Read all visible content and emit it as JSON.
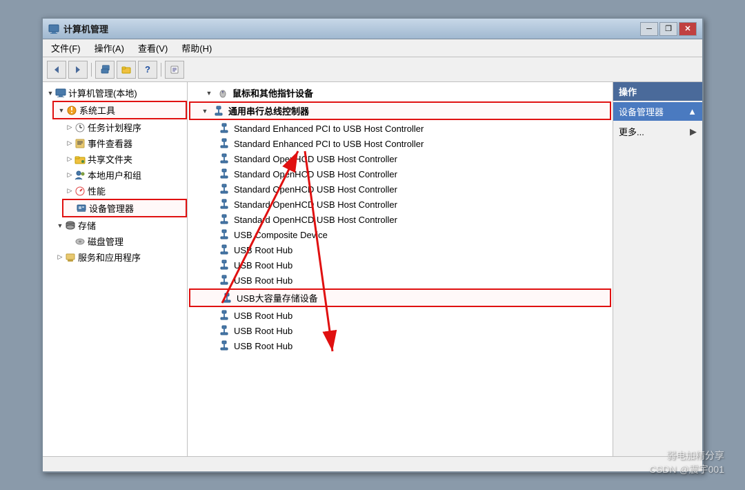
{
  "window": {
    "title": "计算机管理",
    "controls": {
      "minimize": "─",
      "restore": "❐",
      "close": "✕"
    }
  },
  "menu": {
    "items": [
      {
        "id": "file",
        "label": "文件(F)"
      },
      {
        "id": "action",
        "label": "操作(A)"
      },
      {
        "id": "view",
        "label": "查看(V)"
      },
      {
        "id": "help",
        "label": "帮助(H)"
      }
    ]
  },
  "left_panel": {
    "root": "计算机管理(本地)",
    "items": [
      {
        "id": "system-tools",
        "label": "系统工具",
        "indent": 1,
        "expanded": true,
        "highlighted": true
      },
      {
        "id": "task-scheduler",
        "label": "任务计划程序",
        "indent": 2
      },
      {
        "id": "event-viewer",
        "label": "事件查看器",
        "indent": 2
      },
      {
        "id": "shared-folders",
        "label": "共享文件夹",
        "indent": 2
      },
      {
        "id": "local-users",
        "label": "本地用户和组",
        "indent": 2
      },
      {
        "id": "performance",
        "label": "性能",
        "indent": 2
      },
      {
        "id": "device-manager",
        "label": "设备管理器",
        "indent": 2,
        "highlighted": true
      },
      {
        "id": "storage",
        "label": "存储",
        "indent": 1,
        "expanded": true
      },
      {
        "id": "disk-management",
        "label": "磁盘管理",
        "indent": 2
      },
      {
        "id": "services",
        "label": "服务和应用程序",
        "indent": 1
      }
    ]
  },
  "middle_panel": {
    "categories": [
      {
        "id": "mouse-devices",
        "label": "鼠标和其他指针设备",
        "expanded": true,
        "indent": 0
      },
      {
        "id": "usb-controller",
        "label": "通用串行总线控制器",
        "expanded": true,
        "indent": 0,
        "highlighted": true
      }
    ],
    "devices": [
      {
        "id": "dev1",
        "label": "Standard Enhanced PCI to USB Host Controller",
        "indent": 1
      },
      {
        "id": "dev2",
        "label": "Standard Enhanced PCI to USB Host Controller",
        "indent": 1
      },
      {
        "id": "dev3",
        "label": "Standard OpenHCD USB Host Controller",
        "indent": 1
      },
      {
        "id": "dev4",
        "label": "Standard OpenHCD USB Host Controller",
        "indent": 1
      },
      {
        "id": "dev5",
        "label": "Standard OpenHCD USB Host Controller",
        "indent": 1
      },
      {
        "id": "dev6",
        "label": "Standard OpenHCD USB Host Controller",
        "indent": 1
      },
      {
        "id": "dev7",
        "label": "Standard OpenHCD USB Host Controller",
        "indent": 1
      },
      {
        "id": "dev8",
        "label": "USB Composite Device",
        "indent": 1
      },
      {
        "id": "dev9",
        "label": "USB Root Hub",
        "indent": 1
      },
      {
        "id": "dev10",
        "label": "USB Root Hub",
        "indent": 1
      },
      {
        "id": "dev11",
        "label": "USB Root Hub",
        "indent": 1
      },
      {
        "id": "dev12",
        "label": "USB大容量存储设备",
        "indent": 1,
        "highlighted": true
      },
      {
        "id": "dev13",
        "label": "USB Root Hub",
        "indent": 1
      },
      {
        "id": "dev14",
        "label": "USB Root Hub",
        "indent": 1
      },
      {
        "id": "dev15",
        "label": "USB Root Hub",
        "indent": 1
      }
    ]
  },
  "right_panel": {
    "header": "操作",
    "actions": [
      {
        "id": "device-manager-action",
        "label": "设备管理器",
        "primary": true
      },
      {
        "id": "more",
        "label": "更多..."
      }
    ]
  },
  "watermark": {
    "line1": "弱电加精分享",
    "line2": "CSDN @震宇001"
  },
  "icons": {
    "computer": "💻",
    "wrench": "🔧",
    "clock": "🕐",
    "event": "📋",
    "folder": "📁",
    "users": "👥",
    "chart": "📊",
    "device": "🖥️",
    "storage": "💾",
    "disk": "💿",
    "services": "⚙️",
    "usb": "🔌",
    "expand": "▷",
    "collapse": "▽",
    "arrow_right": "▶",
    "arrow_down": "▼"
  }
}
